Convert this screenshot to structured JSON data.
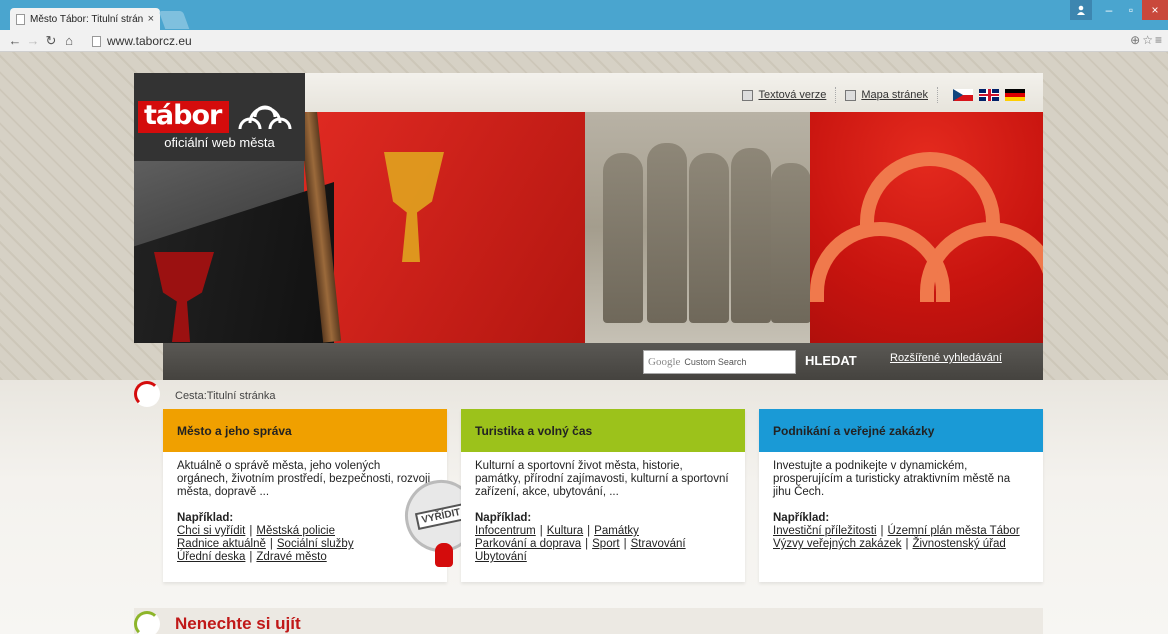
{
  "browser": {
    "tab_title": "Město Tábor: Titulní strán",
    "tab_close": "×",
    "url": "www.taborcz.eu",
    "icons": [
      "back-icon",
      "forward-icon",
      "reload-icon",
      "home-icon",
      "page-icon",
      "zoom-icon",
      "star-icon",
      "menu-icon"
    ],
    "window_controls": [
      "–",
      "▫",
      "×"
    ]
  },
  "header": {
    "logo_word": "tábor",
    "logo_sub": "oficiální web města",
    "text_version": "Textová verze",
    "sitemap": "Mapa stránek",
    "languages": [
      "cz",
      "gb",
      "de"
    ]
  },
  "search": {
    "brand": "Google",
    "placeholder": "Custom Search",
    "button": "HLEDAT",
    "advanced": "Rozšířené vyhledávání"
  },
  "breadcrumb": "Cesta:Titulní stránka",
  "columns": [
    {
      "title": "Město a jeho správa",
      "color": "#f0a000",
      "desc": "Aktuálně o správě města, jeho volených orgánech, životním prostředí, bezpečnosti, rozvoji města, dopravě ...",
      "ex_label": "Například:",
      "links": [
        "Chci si vyřídit",
        "Městská policie",
        "Radnice aktuálně",
        "Sociální služby",
        "Úřední deska",
        "Zdravé město"
      ]
    },
    {
      "title": "Turistika a volný čas",
      "color": "#9cc21b",
      "desc": "Kulturní a sportovní život města, historie, památky, přírodní zajímavosti, kulturní a sportovní zařízení, akce, ubytování, ...",
      "ex_label": "Například:",
      "links": [
        "Infocentrum",
        "Kultura",
        "Památky",
        "Parkování a doprava",
        "Sport",
        "Stravování",
        "Ubytování"
      ]
    },
    {
      "title": "Podnikání a veřejné zakázky",
      "color": "#1a9ad6",
      "desc": "Investujte a podnikejte v dynamickém, prosperujícím a turisticky atraktivním městě na jihu Čech.",
      "ex_label": "Například:",
      "links": [
        "Investiční příležitosti",
        "Územní plán města Tábor",
        "Výzvy veřejných zakázek",
        "Živnostenský úřad"
      ]
    }
  ],
  "badge": {
    "label": "VYŘÍDIT"
  },
  "bottom_title": "Nenechte si ujít"
}
